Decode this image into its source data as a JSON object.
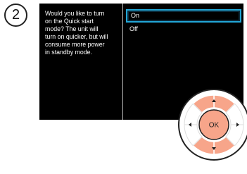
{
  "step": {
    "number": "2"
  },
  "tv": {
    "prompt": "Would you like to turn\non the Quick start\nmode? The unit will\nturn on quicker, but will\nconsume more power\nin standby mode.",
    "options": [
      {
        "label": "On",
        "selected": true
      },
      {
        "label": "Off",
        "selected": false
      }
    ]
  },
  "remote": {
    "ok_label": "OK",
    "highlight_color": "#f7a58a",
    "ring_color": "#222222"
  },
  "colors": {
    "screen_bg": "#000000",
    "selection": "#22a6d6",
    "text": "#ffffff"
  }
}
